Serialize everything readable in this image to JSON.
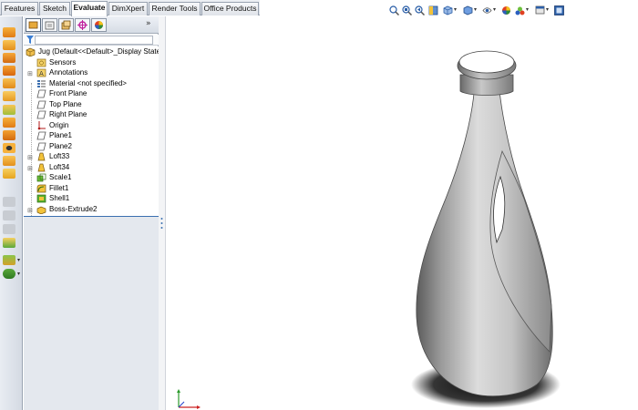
{
  "tabs": [
    {
      "label": "Features",
      "active": false
    },
    {
      "label": "Sketch",
      "active": false
    },
    {
      "label": "Evaluate",
      "active": true
    },
    {
      "label": "DimXpert",
      "active": false
    },
    {
      "label": "Render Tools",
      "active": false
    },
    {
      "label": "Office Products",
      "active": false
    }
  ],
  "feature_manager": {
    "panel_tabs": [
      "feature-manager-icon",
      "property-manager-icon",
      "configuration-manager-icon",
      "dimxpert-manager-icon",
      "display-manager-icon"
    ],
    "expand_arrow": "»",
    "tree": [
      {
        "label": "Jug  (Default<<Default>_Display State",
        "expandable": false,
        "icon": "part-icon",
        "root": true
      },
      {
        "label": "Sensors",
        "expandable": false,
        "icon": "sensor-icon"
      },
      {
        "label": "Annotations",
        "expandable": true,
        "icon": "annotation-icon"
      },
      {
        "label": "Material <not specified>",
        "expandable": false,
        "icon": "material-icon"
      },
      {
        "label": "Front Plane",
        "expandable": false,
        "icon": "plane-icon"
      },
      {
        "label": "Top Plane",
        "expandable": false,
        "icon": "plane-icon"
      },
      {
        "label": "Right Plane",
        "expandable": false,
        "icon": "plane-icon"
      },
      {
        "label": "Origin",
        "expandable": false,
        "icon": "origin-icon"
      },
      {
        "label": "Plane1",
        "expandable": false,
        "icon": "plane-icon"
      },
      {
        "label": "Plane2",
        "expandable": false,
        "icon": "plane-icon"
      },
      {
        "label": "Loft33",
        "expandable": true,
        "icon": "loft-icon"
      },
      {
        "label": "Loft34",
        "expandable": true,
        "icon": "loft-icon"
      },
      {
        "label": "Scale1",
        "expandable": false,
        "icon": "scale-icon"
      },
      {
        "label": "Fillet1",
        "expandable": false,
        "icon": "fillet-icon"
      },
      {
        "label": "Shell1",
        "expandable": false,
        "icon": "shell-icon"
      },
      {
        "label": "Boss-Extrude2",
        "expandable": true,
        "icon": "extrude-icon"
      }
    ]
  },
  "view_toolbar": [
    "zoom-to-fit-icon",
    "zoom-to-area-icon",
    "previous-view-icon",
    "section-view-icon",
    "view-orientation-icon",
    "display-style-icon",
    "hide-show-items-icon",
    "edit-appearance-icon",
    "apply-scene-icon",
    "view-settings-icon",
    "viewport-icon"
  ],
  "colors": {
    "accent": "#3b6fb0",
    "panel": "#e4e8ee",
    "tab_bg": "#dfe3e9"
  },
  "model": {
    "name": "Jug"
  }
}
